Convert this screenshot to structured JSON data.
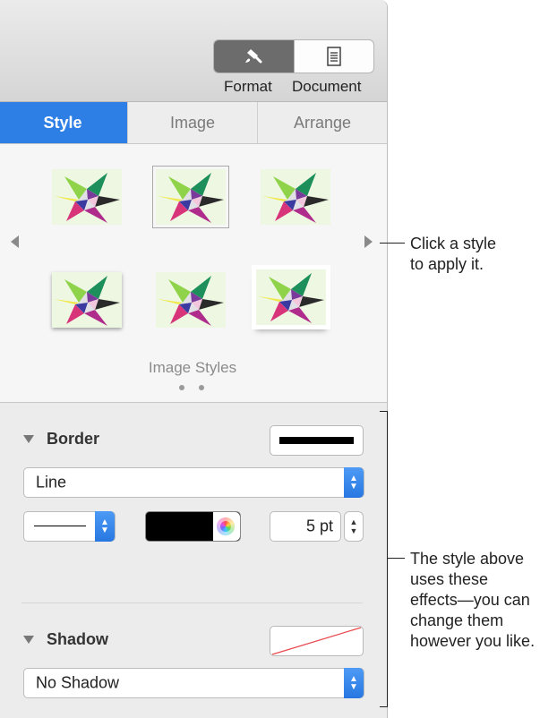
{
  "toolbar": {
    "format_label": "Format",
    "document_label": "Document",
    "format_icon": "paintbrush-icon",
    "document_icon": "document-icon"
  },
  "tabs": [
    {
      "label": "Style",
      "selected": true
    },
    {
      "label": "Image",
      "selected": false
    },
    {
      "label": "Arrange",
      "selected": false
    }
  ],
  "image_styles": {
    "caption": "Image Styles",
    "page_count": 2,
    "current_page": 1
  },
  "border": {
    "title": "Border",
    "type": "Line",
    "line_width": "5 pt",
    "line_color": "#000000"
  },
  "shadow": {
    "title": "Shadow",
    "type": "No Shadow"
  },
  "callouts": {
    "styles": [
      "Click a style",
      "to apply it."
    ],
    "effects": [
      "The style above",
      "uses these",
      "effects—you can",
      "change them",
      "however you like."
    ]
  },
  "colors": {
    "accent": "#2d7fe6"
  }
}
